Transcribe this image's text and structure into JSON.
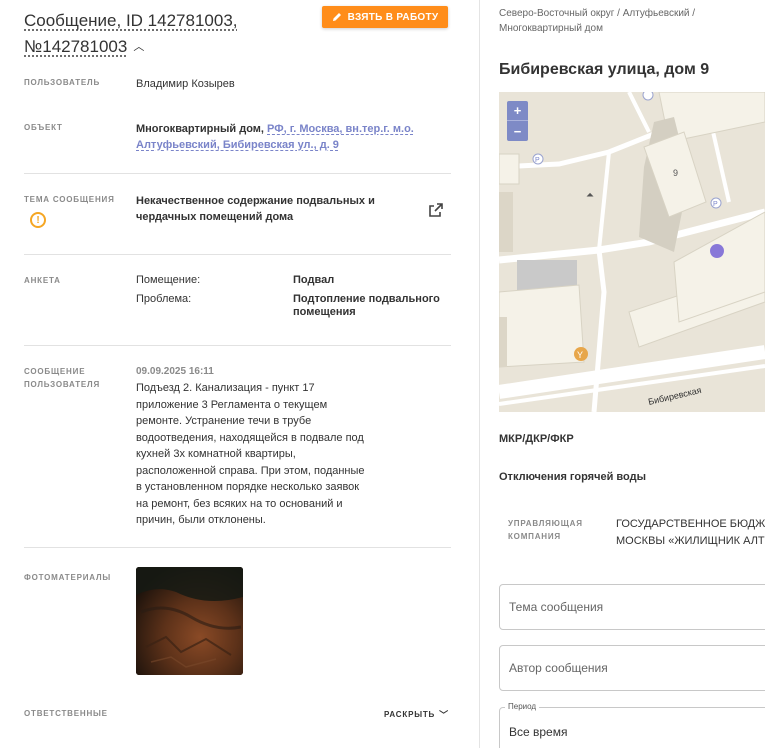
{
  "header": {
    "title": "Сообщение, ID 142781003, №142781003",
    "take_button": "ВЗЯТЬ В РАБОТУ"
  },
  "fields": {
    "user": {
      "label": "ПОЛЬЗОВАТЕЛЬ",
      "value": "Владимир Козырев"
    },
    "object": {
      "label": "ОБЪЕКТ",
      "type": "Многоквартирный дом,",
      "address_line1": "РФ, г. Москва, вн.тер.г. м.о.",
      "address_line2": "Алтуфьевский, Бибиревская ул., д. 9"
    },
    "topic": {
      "label": "ТЕМА СООБЩЕНИЯ",
      "value_line1": "Некачественное содержание подвальных и",
      "value_line2": "чердачных помещений дома"
    },
    "survey": {
      "label": "АНКЕТА",
      "rows": [
        {
          "key": "Помещение:",
          "value": "Подвал"
        },
        {
          "key": "Проблема:",
          "value": "Подтопление подвального помещения"
        }
      ]
    },
    "message": {
      "label_line1": "СООБЩЕНИЕ",
      "label_line2": "ПОЛЬЗОВАТЕЛЯ",
      "date": "09.09.2025 16:11",
      "text": "Подъезд 2. Канализация - пункт 17 приложение 3 Регламента о текущем ремонте. Устранение течи в трубе водоотведения, находящейся в подвале под кухней 3х комнатной квартиры, расположенной справа. При этом, поданные в установленном порядке несколько заявок на ремонт, без всяких на то оснований и причин, были отклонены."
    },
    "photos": {
      "label": "ФОТОМАТЕРИАЛЫ"
    },
    "responsible": {
      "label": "ОТВЕТСТВЕННЫЕ",
      "expand": "РАСКРЫТЬ"
    }
  },
  "right": {
    "breadcrumb_line1": "Северо-Восточный округ / Алтуфьевский /",
    "breadcrumb_line2": "Многоквартирный дом",
    "address": "Бибиревская улица, дом 9",
    "map": {
      "zoom_in": "+",
      "zoom_out": "−",
      "house_number": "9",
      "street_label": "Бибиревская",
      "parking": "P"
    },
    "mkr": "МКР/ДКР/ФКР",
    "hot_water": "Отключения горячей воды",
    "uk": {
      "label_line1": "УПРАВЛЯЮЩАЯ",
      "label_line2": "КОМПАНИЯ",
      "value_line1": "ГОСУДАРСТВЕННОЕ БЮДЖЕТ",
      "value_line2": "МОСКВЫ «ЖИЛИЩНИК АЛТУ"
    },
    "filters": {
      "topic_placeholder": "Тема сообщения",
      "author_placeholder": "Автор сообщения",
      "period_label": "Период",
      "period_value": "Все время"
    }
  },
  "colors": {
    "accent": "#ff8d1a",
    "link": "#7a84c9",
    "warning": "#f5a623",
    "map_marker": "#8878d8"
  }
}
